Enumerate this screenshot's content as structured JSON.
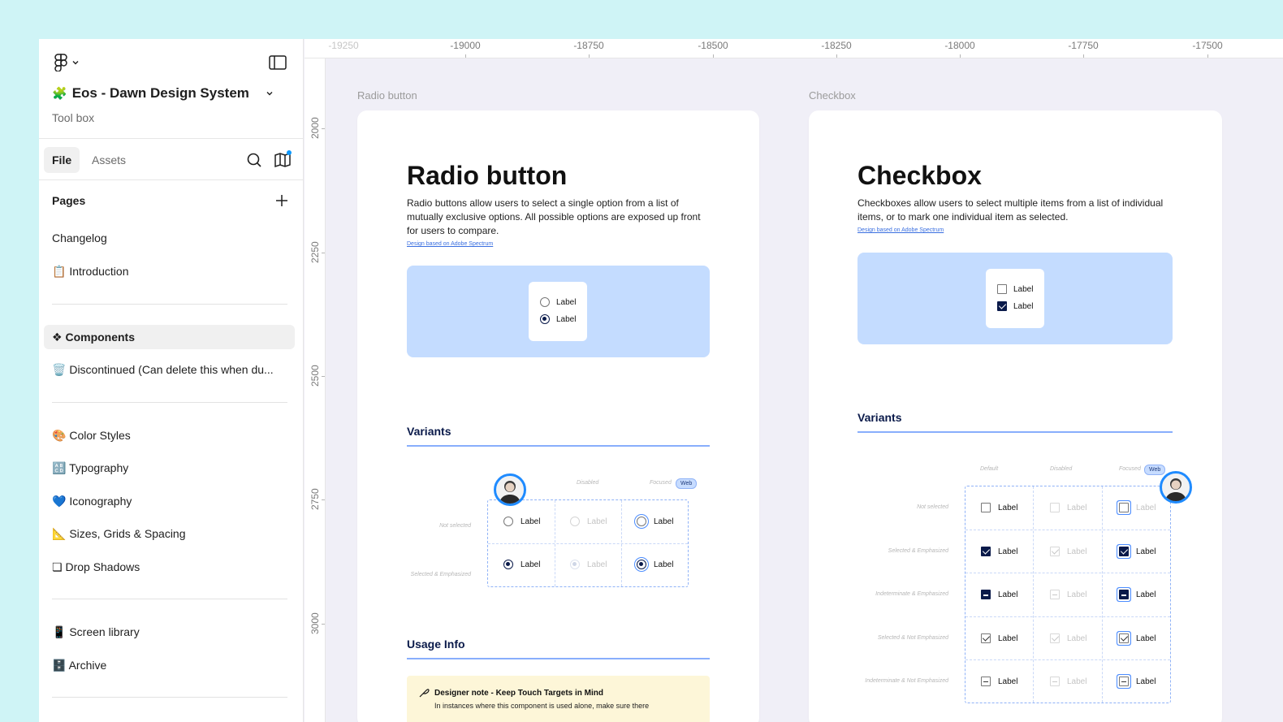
{
  "sidebar": {
    "file_title_emoji": "🧩",
    "file_title": "Eos - Dawn Design System",
    "file_subtitle": "Tool box",
    "tabs": {
      "file": "File",
      "assets": "Assets"
    },
    "pages_heading": "Pages",
    "pages": [
      {
        "emoji": "",
        "label": "Changelog"
      },
      {
        "emoji": "📋",
        "label": "Introduction"
      },
      {
        "emoji": "❖",
        "label": "Components"
      },
      {
        "emoji": "🗑️",
        "label": "Discontinued (Can delete this when du..."
      },
      {
        "emoji": "🎨",
        "label": "Color Styles"
      },
      {
        "emoji": "🔠",
        "label": "Typography"
      },
      {
        "emoji": "💙",
        "label": "Iconography"
      },
      {
        "emoji": "📐",
        "label": "Sizes, Grids & Spacing"
      },
      {
        "emoji": "❏",
        "label": "Drop Shadows"
      },
      {
        "emoji": "📱",
        "label": "Screen library"
      },
      {
        "emoji": "🗄️",
        "label": "Archive"
      }
    ]
  },
  "ruler": {
    "x_labels": [
      "-19250",
      "-19000",
      "-18750",
      "-18500",
      "-18250",
      "-18000",
      "-17750",
      "-17500"
    ],
    "y_labels": [
      "2000",
      "2250",
      "2500",
      "2750",
      "3000"
    ]
  },
  "radio_frame": {
    "frame_label": "Radio button",
    "title": "Radio button",
    "description": "Radio buttons allow users to select a single option from a list of mutually exclusive options. All possible options are exposed up front for users to compare.",
    "link": "Design based on Adobe Spectrum",
    "preview_labels": [
      "Label",
      "Label"
    ],
    "variants_title": "Variants",
    "col_labels": [
      "Disabled",
      "Focused"
    ],
    "web_badge": "Web",
    "row_labels": [
      "Not selected",
      "Selected & Emphasized"
    ],
    "cell_label": "Label",
    "usage_title": "Usage Info",
    "note_title": "Designer note - Keep Touch Targets in Mind",
    "note_text": "In instances where this component is used alone, make sure there"
  },
  "checkbox_frame": {
    "frame_label": "Checkbox",
    "title": "Checkbox",
    "description": "Checkboxes allow users to select multiple items from a list of individual items, or to mark one individual item as selected.",
    "link": "Design based on Adobe Spectrum",
    "preview_labels": [
      "Label",
      "Label"
    ],
    "variants_title": "Variants",
    "col_labels": [
      "Default",
      "Disabled",
      "Focused"
    ],
    "web_badge": "Web",
    "row_labels": [
      "Not selected",
      "Selected & Emphasized",
      "Indeterminate & Emphasized",
      "Selected & Not Emphasized",
      "Indeterminate & Not Emphasized"
    ],
    "cell_label": "Label"
  },
  "colors": {
    "accent": "#0d99ff",
    "navy": "#0a1a4a",
    "preview_bg": "#c4dcff",
    "canvas_bg": "#f0eff7"
  }
}
